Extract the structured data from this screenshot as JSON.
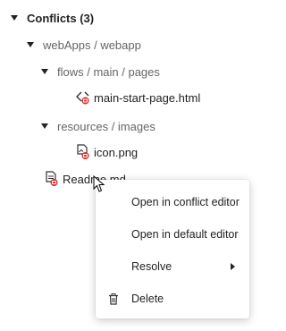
{
  "tree": {
    "root": {
      "label": "Conflicts (3)",
      "expanded": true
    },
    "group": {
      "label": "webApps / webapp",
      "expanded": true
    },
    "folder1": {
      "label": "flows / main / pages",
      "expanded": true
    },
    "file1": {
      "label": "main-start-page.html",
      "icon": "html-conflict-icon"
    },
    "folder2": {
      "label": "resources / images",
      "expanded": true
    },
    "file2": {
      "label": "icon.png",
      "icon": "image-conflict-icon"
    },
    "file3": {
      "label": "Readme.md",
      "icon": "file-conflict-icon"
    }
  },
  "context_menu": {
    "items": [
      {
        "label": "Open in conflict editor"
      },
      {
        "label": "Open in default editor"
      },
      {
        "label": "Resolve",
        "has_submenu": true
      },
      {
        "label": "Delete",
        "icon": "trash-icon"
      }
    ]
  },
  "colors": {
    "conflict_badge": "#d32f2f",
    "text": "#222222",
    "muted": "#666666"
  }
}
